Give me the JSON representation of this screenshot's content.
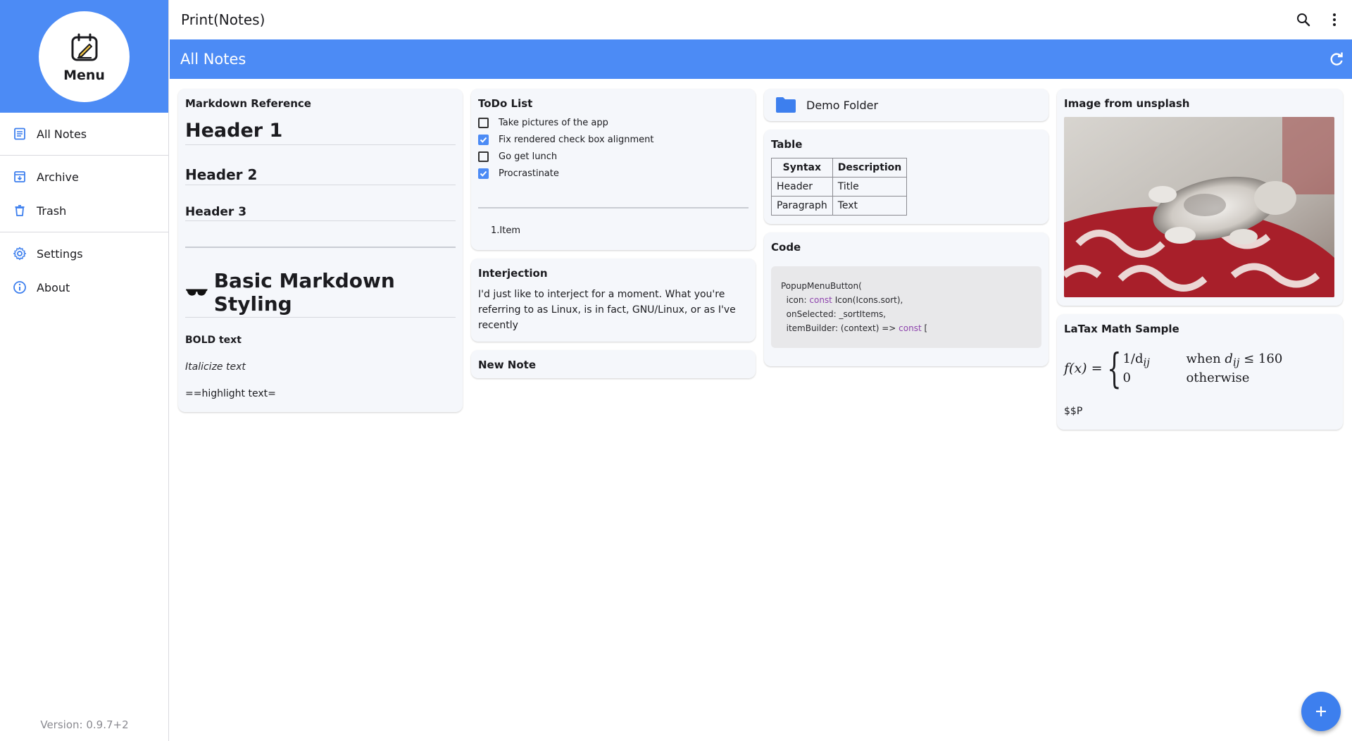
{
  "app": {
    "title": "Print(Notes)"
  },
  "sidebar": {
    "menu_label": "Menu",
    "items": [
      {
        "label": "All Notes",
        "icon": "notes-icon"
      },
      {
        "label": "Archive",
        "icon": "archive-icon"
      },
      {
        "label": "Trash",
        "icon": "trash-icon"
      },
      {
        "label": "Settings",
        "icon": "gear-icon"
      },
      {
        "label": "About",
        "icon": "info-icon"
      }
    ],
    "version": "Version: 0.9.7+2"
  },
  "header": {
    "section_title": "All Notes"
  },
  "notes": {
    "markdown": {
      "title": "Markdown Reference",
      "h1": "Header 1",
      "h2": "Header 2",
      "h3": "Header 3",
      "styling_heading": "Basic Markdown Styling",
      "bold": "BOLD text",
      "italic": "Italicize text",
      "highlight": "==highlight text="
    },
    "todo": {
      "title": "ToDo List",
      "items": [
        {
          "label": "Take pictures of the app",
          "checked": false
        },
        {
          "label": "Fix rendered check box alignment",
          "checked": true
        },
        {
          "label": "Go get lunch",
          "checked": false
        },
        {
          "label": "Procrastinate",
          "checked": true
        }
      ],
      "ordered_item": "1.Item"
    },
    "interjection": {
      "title": "Interjection",
      "body": "I'd just like to interject for a moment.  What you're referring to as Linux, is in fact, GNU/Linux, or as I've recently"
    },
    "new_note": {
      "title": "New Note"
    },
    "folder": {
      "name": "Demo Folder"
    },
    "table": {
      "title": "Table",
      "headers": [
        "Syntax",
        "Description"
      ],
      "rows": [
        [
          "Header",
          "Title"
        ],
        [
          "Paragraph",
          "Text"
        ]
      ]
    },
    "code": {
      "title": "Code",
      "lines": [
        [
          "PopupMenuButton("
        ],
        [
          "  icon: ",
          "const",
          " Icon(Icons.sort),"
        ],
        [
          "  onSelected: _sortItems,"
        ],
        [
          "  itemBuilder: (context) => ",
          "const",
          " ["
        ]
      ]
    },
    "image": {
      "title": "Image from unsplash"
    },
    "latex": {
      "title": "LaTax Math Sample",
      "lhs": "f(x) =",
      "case1_value": "1/d",
      "case1_sub": "ij",
      "case1_cond_pre": "when ",
      "case1_cond_var": "d",
      "case1_cond_sub": "ij",
      "case1_cond_post": " ≤ 160",
      "case2_value": "0",
      "case2_cond": "otherwise",
      "tail": "$$P"
    }
  },
  "colors": {
    "accent": "#4c8bf5",
    "fab": "#3d7fee",
    "card": "#f5f7fb"
  }
}
